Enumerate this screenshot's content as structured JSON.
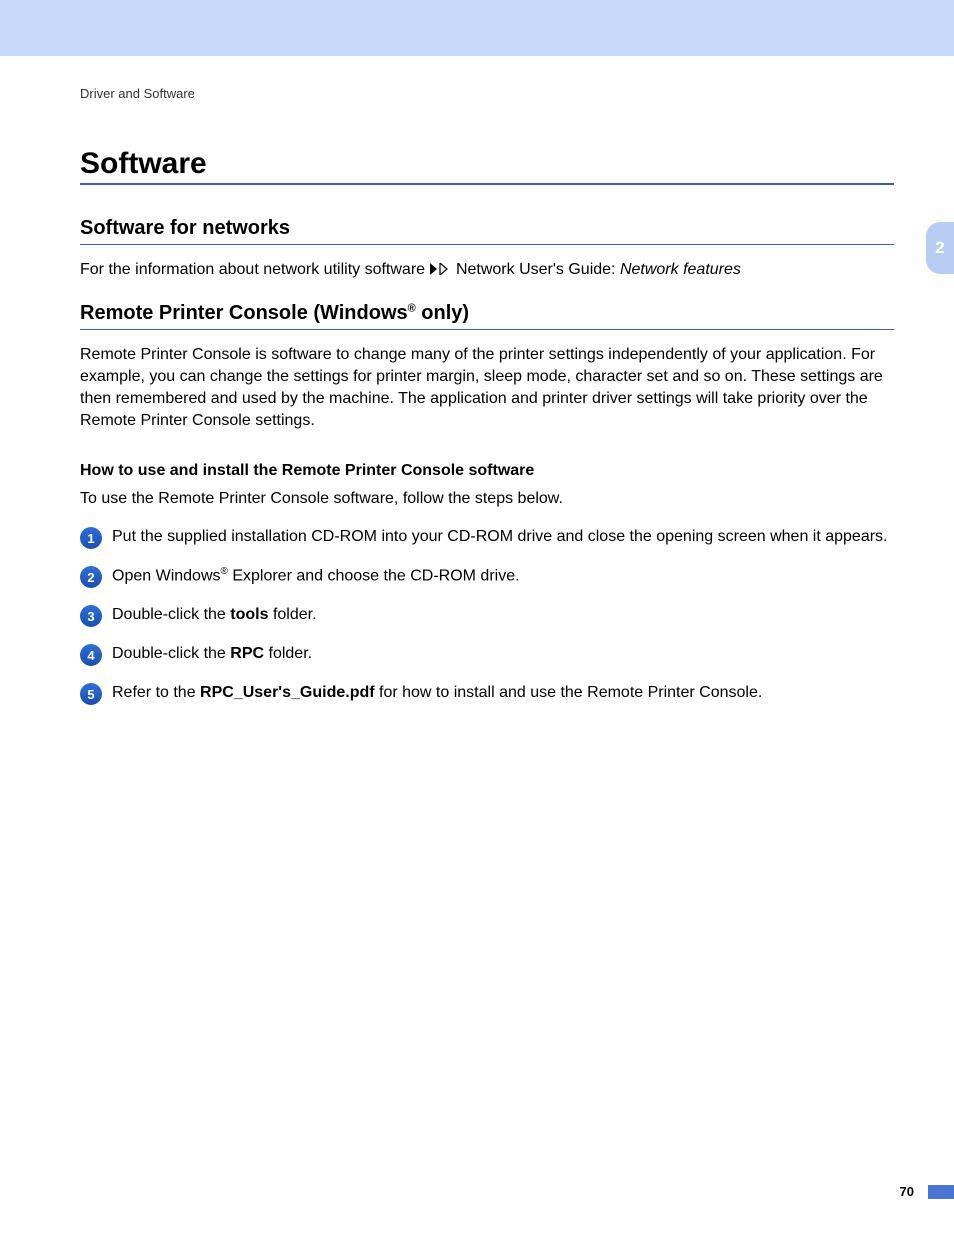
{
  "breadcrumb": "Driver and Software",
  "h1": "Software",
  "section1": {
    "heading": "Software for networks",
    "para_lead": "For the information about network utility software ",
    "para_mid": " Network User's Guide: ",
    "para_italic": "Network features"
  },
  "section2": {
    "heading_pre": "Remote Printer Console (Windows",
    "heading_post": " only)",
    "reg": "®",
    "para": "Remote Printer Console is software to change many of the printer settings independently of your application. For example, you can change the settings for printer margin, sleep mode, character set and so on. These settings are then remembered and used by the machine. The application and printer driver settings will take priority over the Remote Printer Console settings.",
    "sub_heading": "How to use and install the Remote Printer Console software",
    "intro": "To use the Remote Printer Console software, follow the steps below.",
    "steps": [
      {
        "n": "1",
        "pre": "Put the supplied installation CD-ROM into your CD-ROM drive and close the opening screen when it appears.",
        "bold": "",
        "post": ""
      },
      {
        "n": "2",
        "pre": "Open Windows",
        "sup": "®",
        "mid": " Explorer and choose the CD-ROM drive.",
        "bold": "",
        "post": ""
      },
      {
        "n": "3",
        "pre": "Double-click the ",
        "bold": "tools",
        "post": " folder."
      },
      {
        "n": "4",
        "pre": "Double-click the ",
        "bold": "RPC",
        "post": " folder."
      },
      {
        "n": "5",
        "pre": "Refer to the ",
        "bold": "RPC_User's_Guide.pdf",
        "post": " for how to install and use the Remote Printer Console."
      }
    ]
  },
  "tab": "2",
  "page_number": "70"
}
